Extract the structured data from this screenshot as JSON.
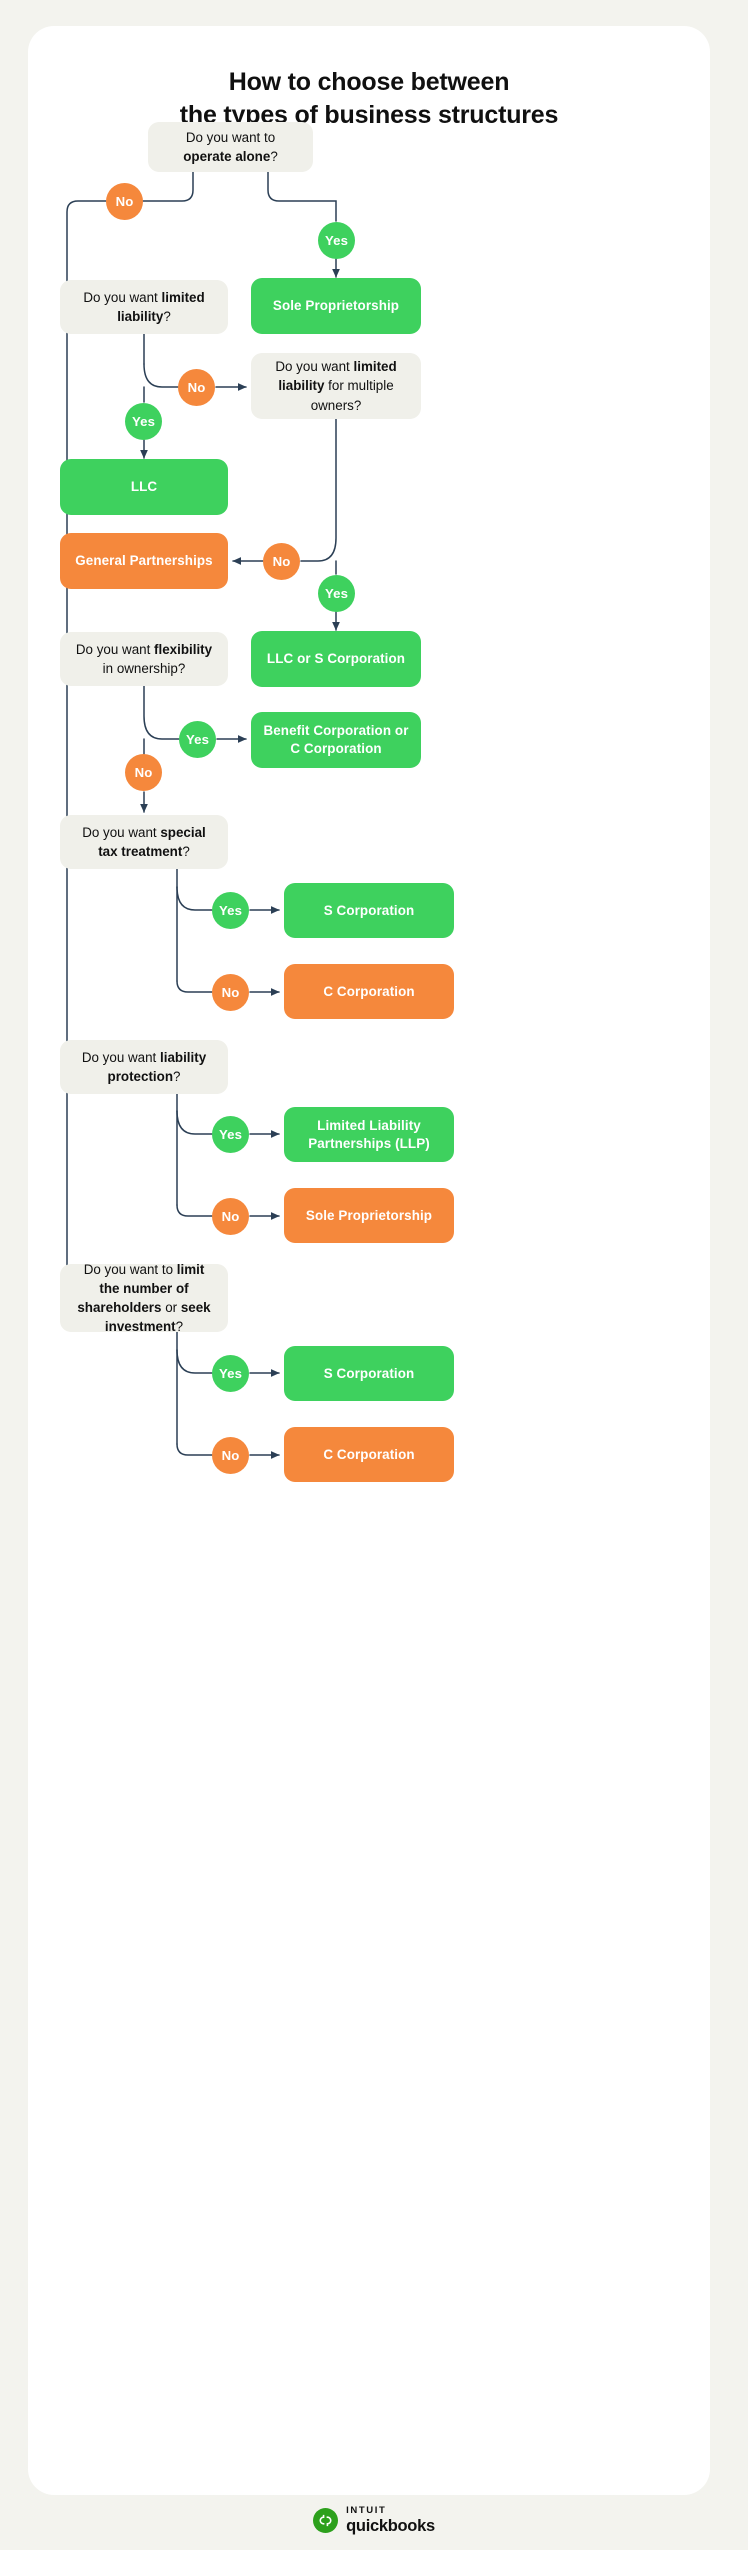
{
  "title": {
    "line1": "How to choose between",
    "line2": "the types of business structures"
  },
  "colors": {
    "page_background": "#f3f3ee",
    "card_background": "#ffffff",
    "question_box": "#f0f0ea",
    "green": "#3ed15e",
    "orange": "#f5883c",
    "connector": "#2b3f55",
    "text_dark": "#111111",
    "text_light": "#ffffff",
    "logo_green": "#2ca01c"
  },
  "labels": {
    "yes": "Yes",
    "no": "No"
  },
  "nodes": {
    "q_operate_alone": {
      "pre": "Do you want to ",
      "strong": "operate alone",
      "post": "?"
    },
    "r_sole_prop_1": "Sole Proprietorship",
    "q_limited_liability": {
      "pre": "Do you want ",
      "strong": "limited liability",
      "post": "?"
    },
    "q_limited_liability_multi": {
      "pre": "Do you want ",
      "strong": "limited liability",
      "post": " for multiple owners?"
    },
    "r_llc": "LLC",
    "r_general_partnerships": "General Partnerships",
    "r_llc_or_s_corp": "LLC or S Corporation",
    "q_flexibility": {
      "pre": "Do you want ",
      "strong": "flexibility",
      "post": " in ownership?"
    },
    "r_benefit_or_c_corp": "Benefit Corporation or C Corporation",
    "q_special_tax": {
      "pre": "Do you want ",
      "strong": "special tax treatment",
      "post": "?"
    },
    "r_s_corp_1": "S Corporation",
    "r_c_corp_1": "C Corporation",
    "q_liability_protection": {
      "pre": "Do you want ",
      "strong": "liability protection",
      "post": "?"
    },
    "r_llp": "Limited Liability Partnerships (LLP)",
    "r_sole_prop_2": "Sole Proprietorship",
    "q_shareholders": {
      "pre": "Do you want to ",
      "strong": "limit the number of shareholders",
      "mid": " or ",
      "strong2": "seek investment",
      "post": "?"
    },
    "r_s_corp_2": "S Corporation",
    "r_c_corp_2": "C Corporation"
  },
  "footer": {
    "brand_top": "INTUIT",
    "brand_bottom": "quickbooks",
    "mark_glyph": "qb"
  },
  "chart_data": {
    "type": "flowchart",
    "title": "How to choose between the types of business structures",
    "decisions": [
      {
        "id": "operate_alone",
        "question": "Do you want to operate alone?",
        "yes": "Sole Proprietorship",
        "no": "Do you want limited liability?"
      },
      {
        "id": "limited_liability",
        "question": "Do you want limited liability?",
        "yes": "LLC",
        "no": "Do you want limited liability for multiple owners?"
      },
      {
        "id": "limited_liability_multi",
        "question": "Do you want limited liability for multiple owners?",
        "yes": "LLC or S Corporation",
        "no": "General Partnerships"
      },
      {
        "id": "flexibility",
        "question": "Do you want flexibility in ownership?",
        "yes": "Benefit Corporation or C Corporation",
        "no": "Do you want special tax treatment?"
      },
      {
        "id": "special_tax",
        "question": "Do you want special tax treatment?",
        "yes": "S Corporation",
        "no": "C Corporation"
      },
      {
        "id": "liability_protection",
        "question": "Do you want liability protection?",
        "yes": "Limited Liability Partnerships (LLP)",
        "no": "Sole Proprietorship"
      },
      {
        "id": "shareholders",
        "question": "Do you want to limit the number of shareholders or seek investment?",
        "yes": "S Corporation",
        "no": "C Corporation"
      }
    ],
    "outcomes": [
      "Sole Proprietorship",
      "LLC",
      "General Partnerships",
      "LLC or S Corporation",
      "Benefit Corporation or C Corporation",
      "S Corporation",
      "C Corporation",
      "Limited Liability Partnerships (LLP)"
    ]
  }
}
